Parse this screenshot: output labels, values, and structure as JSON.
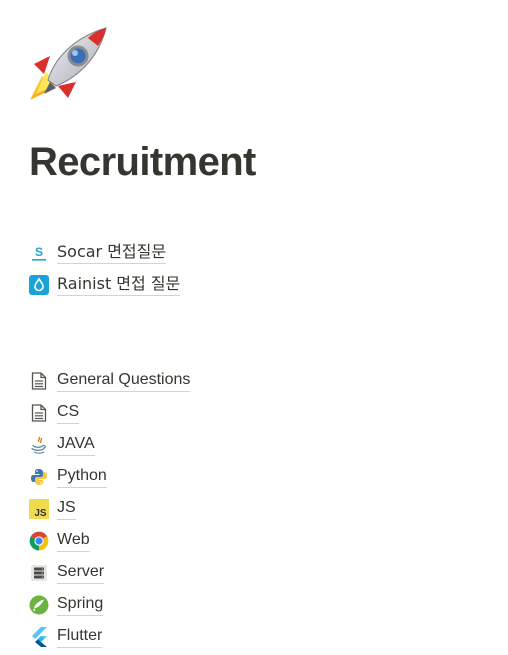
{
  "page": {
    "icon": "rocket-icon",
    "title": "Recruitment"
  },
  "interview_links": [
    {
      "label": "Socar 면접질문",
      "icon": "socar-icon"
    },
    {
      "label": "Rainist 면접 질문",
      "icon": "rainist-drop-icon"
    }
  ],
  "topic_links": [
    {
      "label": "General Questions",
      "icon": "document-icon"
    },
    {
      "label": "CS",
      "icon": "document-icon"
    },
    {
      "label": "JAVA",
      "icon": "java-icon"
    },
    {
      "label": "Python",
      "icon": "python-icon"
    },
    {
      "label": "JS",
      "icon": "javascript-icon",
      "icon_text": "JS"
    },
    {
      "label": "Web",
      "icon": "chrome-icon"
    },
    {
      "label": "Server",
      "icon": "server-icon"
    },
    {
      "label": "Spring",
      "icon": "spring-icon"
    },
    {
      "label": "Flutter",
      "icon": "flutter-icon"
    }
  ],
  "colors": {
    "text": "#37352f",
    "rainist": "#1aa3d9",
    "js_yellow": "#f0db4f",
    "spring_green": "#6db33f",
    "flutter_blue": "#45a6e5"
  }
}
